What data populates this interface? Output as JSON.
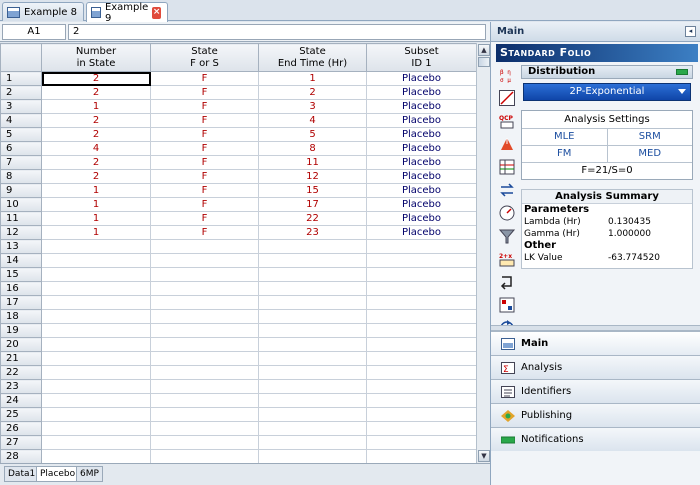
{
  "doc_tabs": [
    {
      "label": "Example 8",
      "active": false
    },
    {
      "label": "Example 9",
      "active": true
    }
  ],
  "cell_ref": "A1",
  "cell_value": "2",
  "columns": [
    {
      "header": "Number\nin State"
    },
    {
      "header": "State\nF or S"
    },
    {
      "header": "State\nEnd Time (Hr)"
    },
    {
      "header": "Subset\nID 1"
    }
  ],
  "rows": [
    {
      "num": "1",
      "cells": [
        "2",
        "F",
        "1",
        "Placebo"
      ]
    },
    {
      "num": "2",
      "cells": [
        "2",
        "F",
        "2",
        "Placebo"
      ]
    },
    {
      "num": "3",
      "cells": [
        "1",
        "F",
        "3",
        "Placebo"
      ]
    },
    {
      "num": "4",
      "cells": [
        "2",
        "F",
        "4",
        "Placebo"
      ]
    },
    {
      "num": "5",
      "cells": [
        "2",
        "F",
        "5",
        "Placebo"
      ]
    },
    {
      "num": "6",
      "cells": [
        "4",
        "F",
        "8",
        "Placebo"
      ]
    },
    {
      "num": "7",
      "cells": [
        "2",
        "F",
        "11",
        "Placebo"
      ]
    },
    {
      "num": "8",
      "cells": [
        "2",
        "F",
        "12",
        "Placebo"
      ]
    },
    {
      "num": "9",
      "cells": [
        "1",
        "F",
        "15",
        "Placebo"
      ]
    },
    {
      "num": "10",
      "cells": [
        "1",
        "F",
        "17",
        "Placebo"
      ]
    },
    {
      "num": "11",
      "cells": [
        "1",
        "F",
        "22",
        "Placebo"
      ]
    },
    {
      "num": "12",
      "cells": [
        "1",
        "F",
        "23",
        "Placebo"
      ]
    },
    {
      "num": "13",
      "cells": [
        "",
        "",
        "",
        ""
      ]
    },
    {
      "num": "14",
      "cells": [
        "",
        "",
        "",
        ""
      ]
    },
    {
      "num": "15",
      "cells": [
        "",
        "",
        "",
        ""
      ]
    },
    {
      "num": "16",
      "cells": [
        "",
        "",
        "",
        ""
      ]
    },
    {
      "num": "17",
      "cells": [
        "",
        "",
        "",
        ""
      ]
    },
    {
      "num": "18",
      "cells": [
        "",
        "",
        "",
        ""
      ]
    },
    {
      "num": "19",
      "cells": [
        "",
        "",
        "",
        ""
      ]
    },
    {
      "num": "20",
      "cells": [
        "",
        "",
        "",
        ""
      ]
    },
    {
      "num": "21",
      "cells": [
        "",
        "",
        "",
        ""
      ]
    },
    {
      "num": "22",
      "cells": [
        "",
        "",
        "",
        ""
      ]
    },
    {
      "num": "23",
      "cells": [
        "",
        "",
        "",
        ""
      ]
    },
    {
      "num": "24",
      "cells": [
        "",
        "",
        "",
        ""
      ]
    },
    {
      "num": "25",
      "cells": [
        "",
        "",
        "",
        ""
      ]
    },
    {
      "num": "26",
      "cells": [
        "",
        "",
        "",
        ""
      ]
    },
    {
      "num": "27",
      "cells": [
        "",
        "",
        "",
        ""
      ]
    },
    {
      "num": "28",
      "cells": [
        "",
        "",
        "",
        ""
      ]
    }
  ],
  "sheet_tabs": [
    {
      "label": "Data1",
      "active": false
    },
    {
      "label": "Placebo",
      "active": true
    },
    {
      "label": "6MP",
      "active": false
    }
  ],
  "panel": {
    "title": "Main",
    "banner": "Standard Folio",
    "distribution_label": "Distribution",
    "distribution_value": "2P-Exponential",
    "analysis_settings": {
      "title": "Analysis Settings",
      "options": [
        "MLE",
        "SRM",
        "FM",
        "MED"
      ],
      "summary_line": "F=21/S=0"
    },
    "analysis_summary": {
      "title": "Analysis Summary",
      "groups": [
        {
          "name": "Parameters",
          "rows": [
            {
              "label": "Lambda (Hr)",
              "value": "0.130435"
            },
            {
              "label": "Gamma (Hr)",
              "value": "1.000000"
            }
          ]
        },
        {
          "name": "Other",
          "rows": [
            {
              "label": "LK Value",
              "value": "-63.774520"
            }
          ]
        }
      ]
    },
    "nav": [
      {
        "label": "Main",
        "active": true,
        "icon": "main-icon"
      },
      {
        "label": "Analysis",
        "active": false,
        "icon": "analysis-icon"
      },
      {
        "label": "Identifiers",
        "active": false,
        "icon": "identifiers-icon"
      },
      {
        "label": "Publishing",
        "active": false,
        "icon": "publishing-icon"
      },
      {
        "label": "Notifications",
        "active": false,
        "icon": "notifications-icon"
      }
    ]
  },
  "colors": {
    "data_text": "#b00000",
    "id_text": "#00006a",
    "banner": "#0c2e6b",
    "dropdown": "#1a57c4"
  }
}
